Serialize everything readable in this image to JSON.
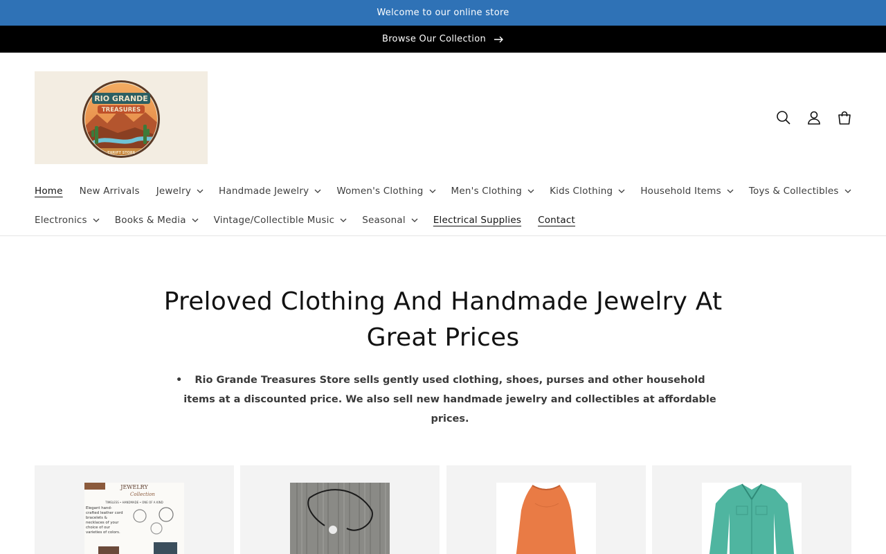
{
  "announcement": {
    "welcome": "Welcome to our online store",
    "browse": "Browse Our Collection"
  },
  "brand": {
    "logo_title_top": "RIO GRANDE",
    "logo_title_mid": "TREASURES",
    "logo_subtitle": "THRIFT STORE"
  },
  "header_icons": [
    "search-icon",
    "account-icon",
    "cart-icon"
  ],
  "nav": {
    "row1": [
      {
        "label": "Home",
        "dropdown": false,
        "active": true
      },
      {
        "label": "New Arrivals",
        "dropdown": false
      },
      {
        "label": "Jewelry",
        "dropdown": true
      },
      {
        "label": "Handmade Jewelry",
        "dropdown": true
      },
      {
        "label": "Women's Clothing",
        "dropdown": true
      },
      {
        "label": "Men's Clothing",
        "dropdown": true
      },
      {
        "label": "Kids Clothing",
        "dropdown": true
      },
      {
        "label": "Household Items",
        "dropdown": true
      },
      {
        "label": "Toys & Collectibles",
        "dropdown": true
      }
    ],
    "row2": [
      {
        "label": "Electronics",
        "dropdown": true
      },
      {
        "label": "Books & Media",
        "dropdown": true
      },
      {
        "label": "Vintage/Collectible Music",
        "dropdown": true
      },
      {
        "label": "Seasonal",
        "dropdown": true
      },
      {
        "label": "Electrical Supplies",
        "dropdown": false,
        "underlined": true
      },
      {
        "label": "Contact",
        "dropdown": false,
        "underlined": true
      }
    ]
  },
  "hero": {
    "title": "Preloved Clothing And Handmade Jewelry At Great Prices",
    "bullet": "Rio Grande Treasures Store sells gently used clothing, shoes, purses and other household items at a discounted price. We also sell new handmade jewelry and collectibles at affordable prices."
  },
  "products": {
    "card1": {
      "top_text": "JEWELRY",
      "script": "Collection",
      "tags": "TIMELESS  •  HANDMADE  •  ONE OF A KIND",
      "desc": "Elegant hand-crafted leather cord bracelets & necklaces of your choice of our varieties of colors."
    }
  },
  "colors": {
    "announce_bar": "#2f72b6",
    "browse_bar": "#000000",
    "card_bg": "#f3f3f3"
  }
}
